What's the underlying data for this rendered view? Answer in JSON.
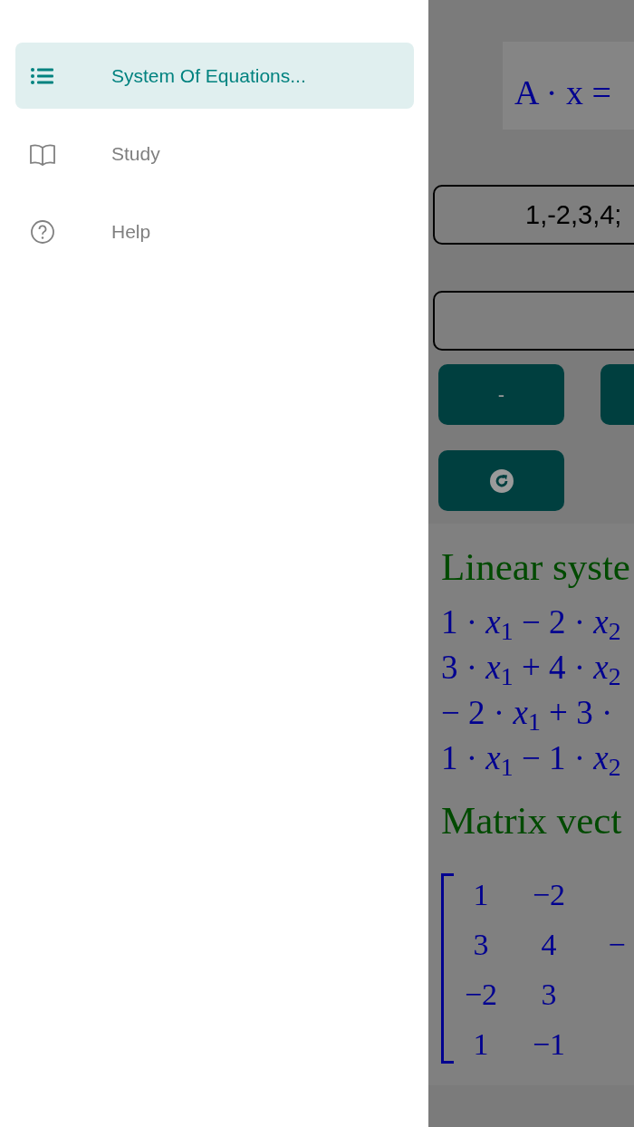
{
  "drawer": {
    "items": [
      {
        "kind": "list",
        "label": "System Of Equations...",
        "selected": true
      },
      {
        "kind": "book",
        "label": "Study",
        "selected": false
      },
      {
        "kind": "help",
        "label": "Help",
        "selected": false
      }
    ]
  },
  "main": {
    "formula": "A · x =",
    "inputs": [
      {
        "kind": "input",
        "value": "1,-2,3,4;"
      },
      {
        "kind": "input"
      }
    ],
    "button_rows": [
      [
        {
          "kind": "text",
          "label": "-"
        },
        {
          "kind": "blank"
        }
      ],
      [
        {
          "kind": "refresh"
        }
      ]
    ],
    "result": {
      "system_heading": "Linear syste",
      "equations": [
        "1 · *x*$_{1}$ − 2 · *x*$_{2}$",
        "3 · *x*$_{1}$ + 4 · *x*$_{2}$",
        "− 2 · *x*$_{1}$ + 3 ·",
        "1 · *x*$_{1}$ − 1 · *x*$_{2}$"
      ],
      "matrix_heading": "Matrix vect",
      "matrix_rows": [
        [
          "1",
          "−2"
        ],
        [
          "3",
          "4",
          "−"
        ],
        [
          "−2",
          "3"
        ],
        [
          "1",
          "−1"
        ]
      ]
    }
  }
}
